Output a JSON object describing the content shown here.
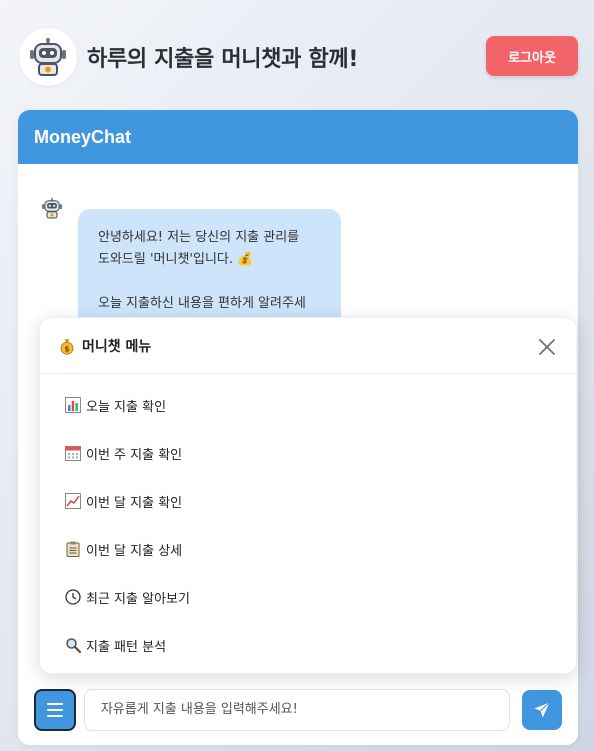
{
  "header": {
    "title": "하루의 지출을 머니챗과 함께!",
    "logout_label": "로그아웃"
  },
  "chat": {
    "app_name": "MoneyChat",
    "bot_message": "안녕하세요! 저는 당신의 지출 관리를\n도와드릴 '머니챗'입니다. 💰\n\n오늘 지출하신 내용을 편하게 알려주세",
    "input_placeholder": "자유롭게 지출 내용을 입력해주세요!"
  },
  "menu": {
    "title": "머니챗 메뉴",
    "title_icon": "money-bag-icon",
    "items": [
      {
        "label": "오늘 지출 확인",
        "icon": "bar-chart-icon"
      },
      {
        "label": "이번 주 지출 확인",
        "icon": "calendar-icon"
      },
      {
        "label": "이번 달 지출 확인",
        "icon": "trend-chart-icon"
      },
      {
        "label": "이번 달 지출 상세",
        "icon": "clipboard-icon"
      },
      {
        "label": "최근 지출 알아보기",
        "icon": "clock-icon"
      },
      {
        "label": "지출 패턴 분석",
        "icon": "magnifier-icon"
      }
    ]
  },
  "colors": {
    "accent": "#4196e0",
    "logout": "#f2646a",
    "bubble": "#cde4fb"
  }
}
